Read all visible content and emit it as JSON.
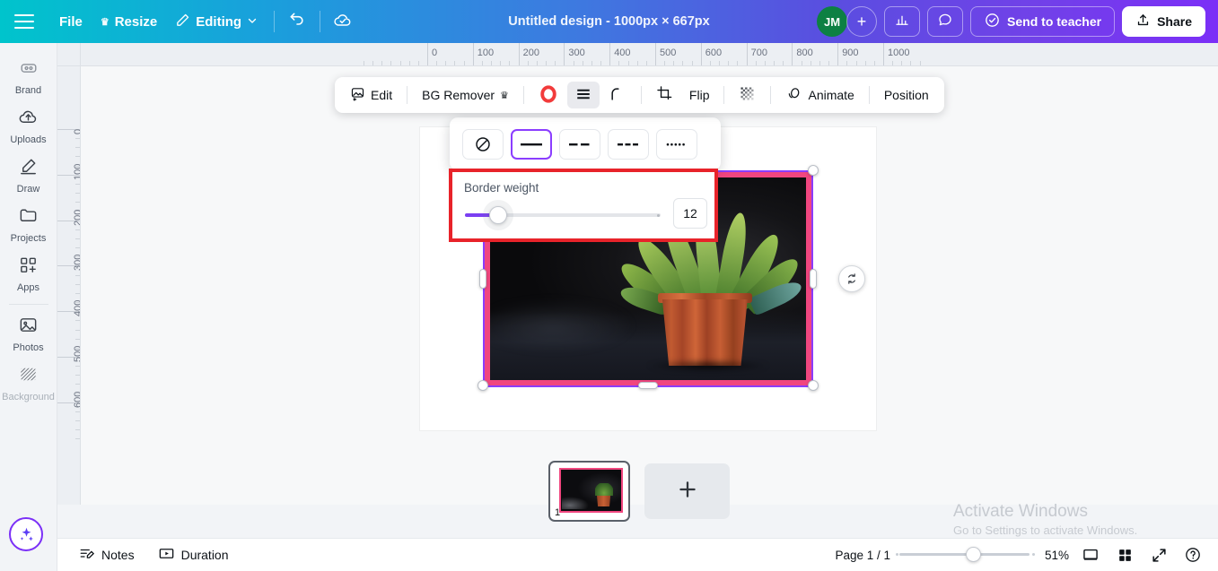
{
  "topbar": {
    "menu_icon": "hamburger-icon",
    "file_label": "File",
    "resize_label": "Resize",
    "resize_badge": "crown-icon",
    "editing_label": "Editing",
    "undo_icon": "undo-arrow-icon",
    "sync_icon": "cloud-check-icon",
    "doc_title": "Untitled design - 1000px × 667px",
    "avatar_initials": "JM",
    "add_people_icon": "plus-icon",
    "insights_icon": "bar-chart-icon",
    "comment_icon": "speech-bubble-icon",
    "send_label": "Send to teacher",
    "send_icon": "check-circle-icon",
    "share_label": "Share",
    "share_icon": "upload-icon"
  },
  "sidebar": {
    "items": [
      {
        "label": "Brand",
        "icon": "brand-badge-icon",
        "dim": false
      },
      {
        "label": "Uploads",
        "icon": "cloud-upload-icon",
        "dim": false
      },
      {
        "label": "Draw",
        "icon": "pen-icon",
        "dim": false
      },
      {
        "label": "Projects",
        "icon": "folder-icon",
        "dim": false
      },
      {
        "label": "Apps",
        "icon": "apps-grid-plus-icon",
        "dim": false
      },
      {
        "label": "Photos",
        "icon": "photo-icon",
        "dim": false
      },
      {
        "label": "Background",
        "icon": "texture-icon",
        "dim": true
      }
    ],
    "magic_button_icon": "sparkle-icon"
  },
  "rulers": {
    "horizontal": [
      "0",
      "100",
      "200",
      "300",
      "400",
      "500",
      "600",
      "700",
      "800",
      "900",
      "1000"
    ],
    "vertical": [
      "0",
      "100",
      "200",
      "300",
      "400",
      "500",
      "600"
    ]
  },
  "toolbar": {
    "edit_label": "Edit",
    "edit_icon": "image-edit-icon",
    "bg_remover_label": "BG Remover",
    "bg_remover_badge": "crown-icon",
    "border_color_icon": "border-color-ring-icon",
    "border_style_icon": "border-style-lines-icon",
    "corner_radius_icon": "corner-radius-arc-icon",
    "crop_icon": "crop-icon",
    "flip_label": "Flip",
    "transparency_icon": "checkerboard-icon",
    "animate_label": "Animate",
    "animate_icon": "animate-icon",
    "position_label": "Position"
  },
  "border_panel": {
    "styles": [
      {
        "name": "none",
        "icon": "circle-slash-icon",
        "selected": false
      },
      {
        "name": "solid",
        "icon": "solid-line-icon",
        "selected": true
      },
      {
        "name": "long-dash",
        "icon": "long-dash-line-icon",
        "selected": false
      },
      {
        "name": "short-dash",
        "icon": "short-dash-line-icon",
        "selected": false
      },
      {
        "name": "dotted",
        "icon": "dotted-line-icon",
        "selected": false
      }
    ],
    "weight_label": "Border weight",
    "weight_value": "12",
    "highlight_color": "#e8232a",
    "accent_color": "#7b3ff2"
  },
  "canvas": {
    "selection_outline_color": "#8b3dff",
    "image_border_color": "#f0467f",
    "rotate_icon": "rotate-icon",
    "image_alt": "succulent plant in faceted terracotta pot on dark background"
  },
  "pages": {
    "thumb_number": "1",
    "add_page_icon": "plus-icon"
  },
  "bottombar": {
    "notes_label": "Notes",
    "notes_icon": "notes-pencil-icon",
    "duration_label": "Duration",
    "duration_icon": "duration-play-icon",
    "page_indicator": "Page 1 / 1",
    "zoom_percent": "51%",
    "presenter_icon": "presenter-view-icon",
    "grid_icon": "grid-view-icon",
    "fullscreen_icon": "expand-icon",
    "help_icon": "help-question-icon"
  },
  "watermark": {
    "line1": "Activate Windows",
    "line2": "Go to Settings to activate Windows."
  }
}
